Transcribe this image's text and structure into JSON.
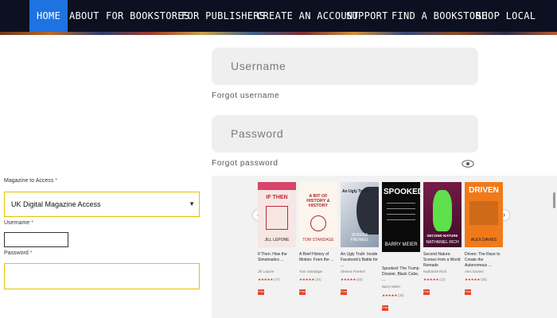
{
  "nav": {
    "items": [
      {
        "label": "HOME",
        "active": true
      },
      {
        "label": "ABOUT"
      },
      {
        "label": "FOR BOOKSTORES"
      },
      {
        "label": "FOR PUBLISHERS"
      },
      {
        "label": "CREATE AN ACCOUNT"
      },
      {
        "label": "SUPPORT"
      },
      {
        "label": "FIND A BOOKSTORE"
      },
      {
        "label": "SHOP LOCAL"
      }
    ]
  },
  "login": {
    "username_placeholder": "Username",
    "forgot_username": "Forgot username",
    "password_placeholder": "Password",
    "forgot_password": "Forgot password"
  },
  "magazine_form": {
    "magazine_label": "Magazine to Access",
    "required_mark": "*",
    "magazine_value": "UK Digital Magazine Access",
    "username_label": "Username",
    "password_label": "Password"
  },
  "books": [
    {
      "cover_title": "IF THEN",
      "cover_author": "JILL LEPORE",
      "title": "If Then: How the Simulmatics ...",
      "author": "Jill Lepore",
      "rating_count": "(47)",
      "badge": "Free"
    },
    {
      "cover_title": "A BIT OF HISTORY & HISTORY",
      "cover_author": "TOM STANDAGE",
      "title": "A Brief History of Motion: From the ...",
      "author": "Tom Standage",
      "rating_count": "(24)",
      "badge": "Free"
    },
    {
      "cover_title": "An Ugly Truth",
      "cover_author": "SHEERA FRENKEL",
      "title": "An Ugly Truth: Inside Facebook's Battle for ...",
      "author": "Sheera Frenkel",
      "rating_count": "(63)",
      "badge": "Free"
    },
    {
      "cover_title": "SPOOKED",
      "cover_author": "BARRY MEIER",
      "title": "Spooked: The Trump Dossier, Black Cube, ...",
      "author": "Barry Meier",
      "rating_count": "(30)",
      "badge": "Free"
    },
    {
      "cover_title": "SECOND NATURE",
      "cover_author": "NATHANIEL RICH",
      "title": "Second Nature: Scenes from a World Remade",
      "author": "Nathaniel Rich",
      "rating_count": "(12)",
      "badge": "Free"
    },
    {
      "cover_title": "DRIVEN",
      "cover_author": "ALEX DAVIES",
      "title": "Driven: The Race to Create the Autonomous ...",
      "author": "Alex Davies",
      "rating_count": "(38)",
      "badge": "Free"
    }
  ],
  "colors": {
    "nav_bg": "#0d1021",
    "nav_active": "#1e73e0",
    "field_bg": "#efefef",
    "select_border": "#e5c200",
    "star": "#d8342c",
    "badge": "#e8452c"
  }
}
